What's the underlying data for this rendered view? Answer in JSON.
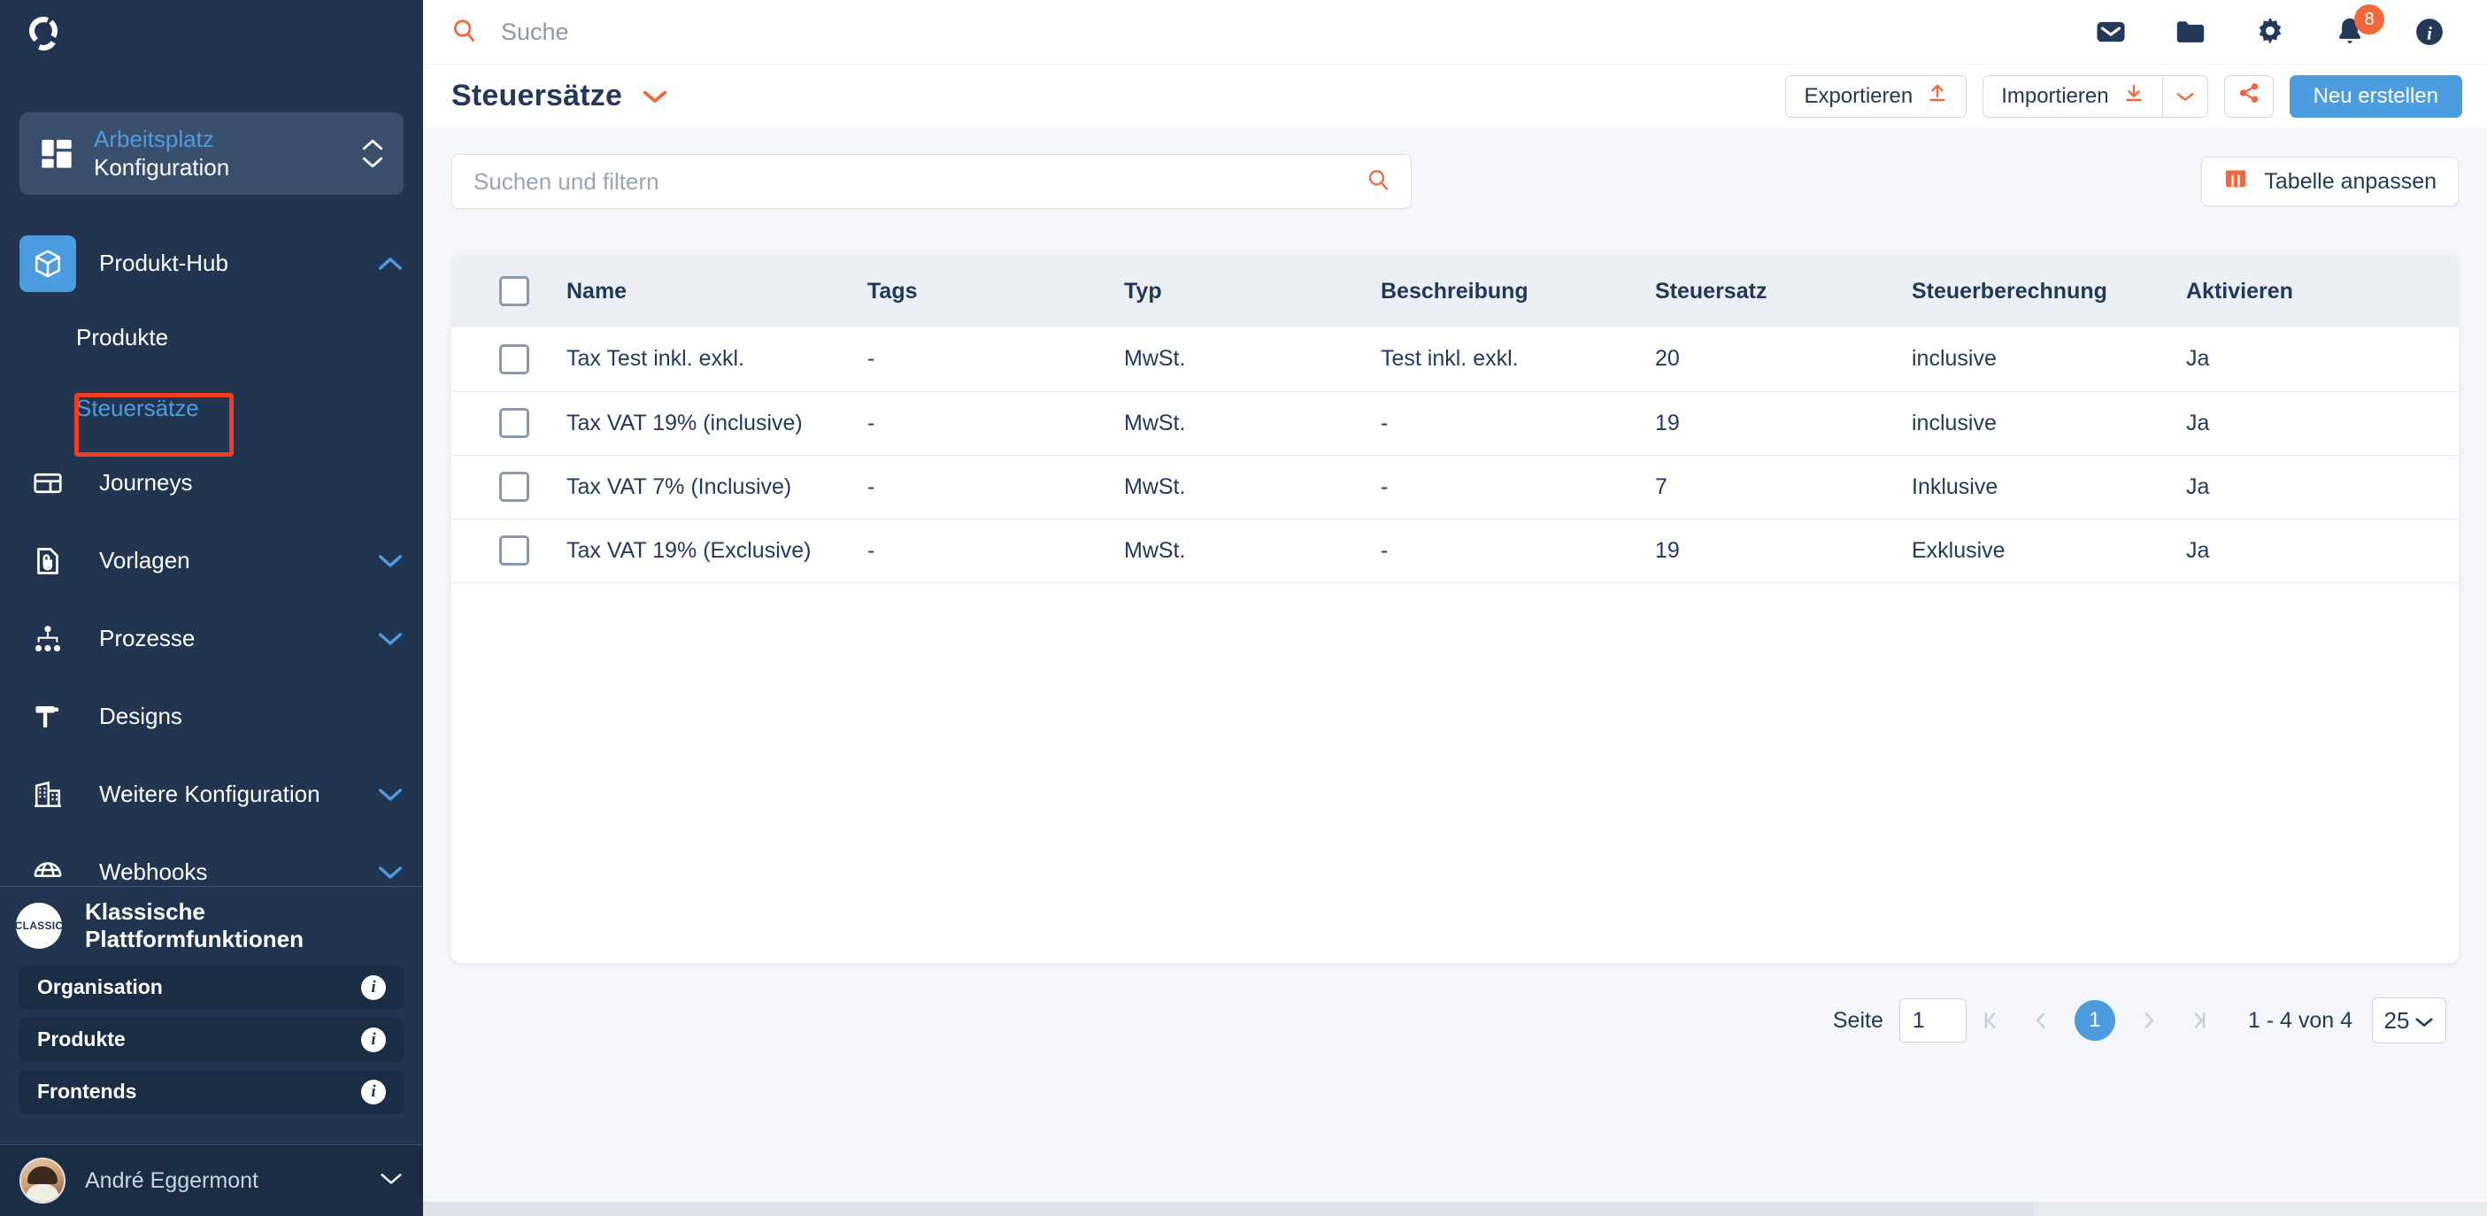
{
  "sidebar": {
    "logo_name": "platform-logo",
    "workspace": {
      "title": "Arbeitsplatz",
      "subtitle": "Konfiguration"
    },
    "nav": [
      {
        "label": "Produkt-Hub",
        "icon": "cube-icon",
        "active": true,
        "expanded": true,
        "chevron": "up"
      },
      {
        "label": "Journeys",
        "icon": "journeys-icon",
        "chevron": ""
      },
      {
        "label": "Vorlagen",
        "icon": "template-icon",
        "chevron": "down"
      },
      {
        "label": "Prozesse",
        "icon": "processes-icon",
        "chevron": "down"
      },
      {
        "label": "Designs",
        "icon": "designs-icon",
        "chevron": ""
      },
      {
        "label": "Weitere Konfiguration",
        "icon": "building-icon",
        "chevron": "down"
      },
      {
        "label": "Webhooks",
        "icon": "globe-icon",
        "chevron": "down"
      }
    ],
    "subnav": [
      {
        "label": "Produkte",
        "selected": false
      },
      {
        "label": "Steuersätze",
        "selected": true
      }
    ],
    "classic": {
      "badge": "CLASSIC",
      "label": "Klassische Plattformfunktionen"
    },
    "accordions": [
      {
        "label": "Organisation",
        "info": "i"
      },
      {
        "label": "Produkte",
        "info": "i"
      },
      {
        "label": "Frontends",
        "info": "i"
      }
    ],
    "user": {
      "name": "André Eggermont"
    }
  },
  "topbar": {
    "search_placeholder": "Suche",
    "search_value": "",
    "icons": [
      {
        "name": "mail-icon"
      },
      {
        "name": "folder-icon"
      },
      {
        "name": "gear-icon"
      },
      {
        "name": "bell-icon",
        "badge": "8"
      },
      {
        "name": "info-icon"
      }
    ]
  },
  "page": {
    "title": "Steuersätze",
    "actions": {
      "export": "Exportieren",
      "import": "Importieren",
      "share": "share-icon",
      "create": "Neu erstellen"
    }
  },
  "filters": {
    "search_placeholder": "Suchen und filtern",
    "search_value": "",
    "customize_table": "Tabelle anpassen"
  },
  "table": {
    "columns": [
      "Name",
      "Tags",
      "Typ",
      "Beschreibung",
      "Steuersatz",
      "Steuerberechnung",
      "Aktivieren"
    ],
    "rows": [
      {
        "name": "Tax Test inkl. exkl.",
        "tags": "-",
        "typ": "MwSt.",
        "beschreibung": "Test inkl. exkl.",
        "steuersatz": "20",
        "steuerberechnung": "inclusive",
        "aktivieren": "Ja"
      },
      {
        "name": "Tax VAT 19% (inclusive)",
        "tags": "-",
        "typ": "MwSt.",
        "beschreibung": "-",
        "steuersatz": "19",
        "steuerberechnung": "inclusive",
        "aktivieren": "Ja"
      },
      {
        "name": "Tax VAT 7% (Inclusive)",
        "tags": "-",
        "typ": "MwSt.",
        "beschreibung": "-",
        "steuersatz": "7",
        "steuerberechnung": "Inklusive",
        "aktivieren": "Ja"
      },
      {
        "name": "Tax VAT 19% (Exclusive)",
        "tags": "-",
        "typ": "MwSt.",
        "beschreibung": "-",
        "steuersatz": "19",
        "steuerberechnung": "Exklusive",
        "aktivieren": "Ja"
      }
    ]
  },
  "pagination": {
    "page_label": "Seite",
    "page_value": "1",
    "current_page": "1",
    "range_text": "1 - 4 von 4",
    "page_size": "25"
  },
  "colors": {
    "sidebar_bg": "#223550",
    "accent_blue": "#4E9CE0",
    "accent_orange": "#F2683C",
    "highlight_red": "#F03E22",
    "text_dark": "#24385A"
  }
}
